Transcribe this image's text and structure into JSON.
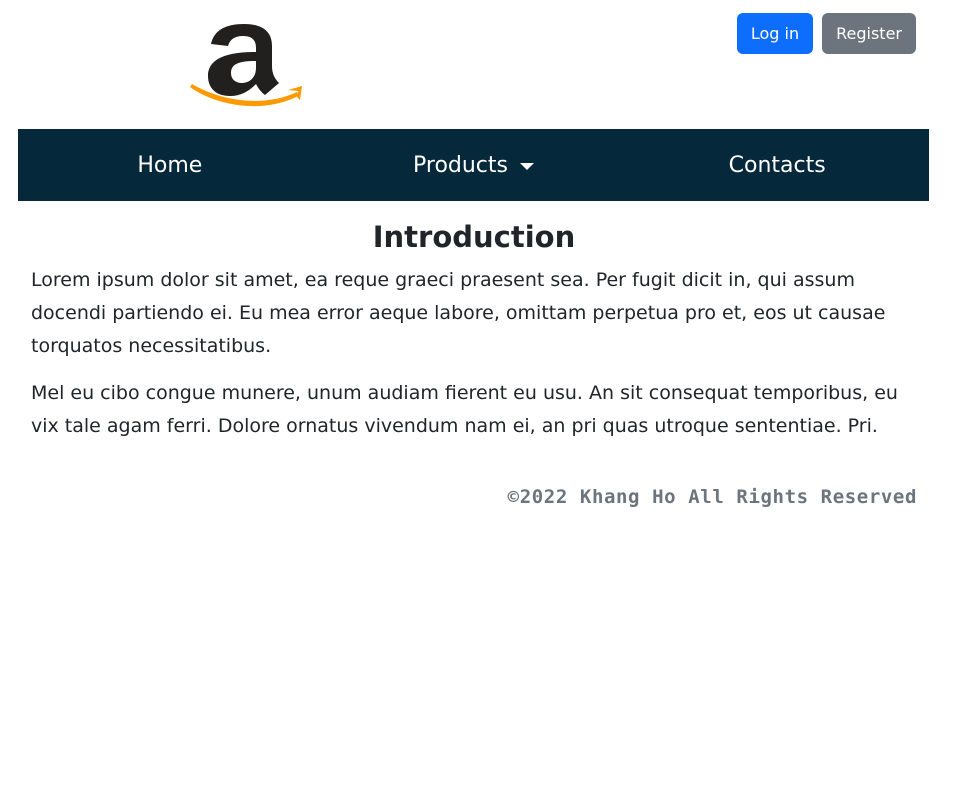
{
  "header": {
    "logo_icon": "amazon-logo",
    "logo_colors": {
      "letter": "#221f1f",
      "smile": "#ff9900"
    },
    "login_label": "Log in",
    "register_label": "Register"
  },
  "nav": {
    "background": "#05283b",
    "items": [
      {
        "label": "Home"
      },
      {
        "label": "Products",
        "dropdown": true
      },
      {
        "label": "Contacts"
      }
    ]
  },
  "main": {
    "title": "Introduction",
    "paragraphs": [
      "Lorem ipsum dolor sit amet, ea reque graeci praesent sea. Per fugit dicit in, qui assum docendi partiendo ei. Eu mea error aeque labore, omittam perpetua pro et, eos ut causae torquatos necessitatibus.",
      "Mel eu cibo congue munere, unum audiam fierent eu usu. An sit consequat temporibus, eu vix tale agam ferri. Dolore ornatus vivendum nam ei, an pri quas utroque sententiae. Pri."
    ]
  },
  "footer": {
    "copyright": "©2022 Khang Ho All Rights Reserved"
  },
  "colors": {
    "primary_button": "#0d6efd",
    "secondary_button": "#6c757d"
  }
}
